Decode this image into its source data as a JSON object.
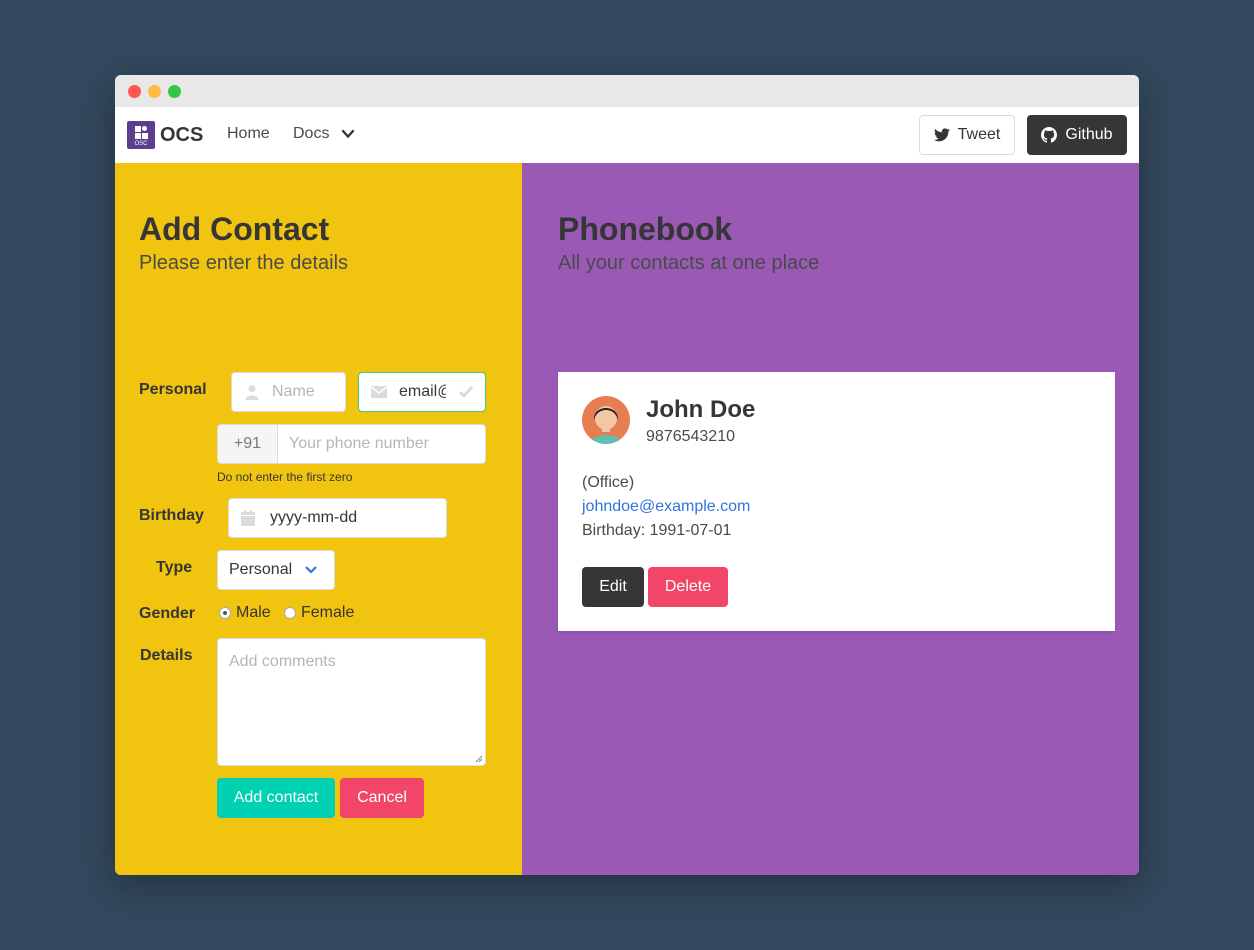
{
  "navbar": {
    "brand": "OCS",
    "brand_logo_text": "OSC",
    "links": {
      "home": "Home",
      "docs": "Docs"
    },
    "tweet_label": "Tweet",
    "github_label": "Github"
  },
  "add_contact": {
    "title": "Add Contact",
    "subtitle": "Please enter the details",
    "labels": {
      "personal": "Personal",
      "birthday": "Birthday",
      "type": "Type",
      "gender": "Gender",
      "details": "Details"
    },
    "name_placeholder": "Name",
    "email_value": "email@",
    "phone_prefix": "+91",
    "phone_placeholder": "Your phone number",
    "phone_help": "Do not enter the first zero",
    "birthday_value": "yyyy-mm-dd",
    "type_selected": "Personal",
    "gender_options": [
      "Male",
      "Female"
    ],
    "gender_selected": "Male",
    "details_placeholder": "Add comments",
    "add_button": "Add contact",
    "cancel_button": "Cancel"
  },
  "phonebook": {
    "title": "Phonebook",
    "subtitle": "All your contacts at one place",
    "contacts": [
      {
        "name": "John Doe",
        "phone": "9876543210",
        "type": "(Office)",
        "email": "johndoe@example.com",
        "birthday": "Birthday: 1991-07-01",
        "edit_label": "Edit",
        "delete_label": "Delete"
      }
    ]
  },
  "colors": {
    "left_bg": "#f1c40f",
    "right_bg": "#9b59b6",
    "primary": "#00d1b2",
    "danger": "#f14668",
    "dark": "#363636",
    "link": "#3273dc"
  }
}
